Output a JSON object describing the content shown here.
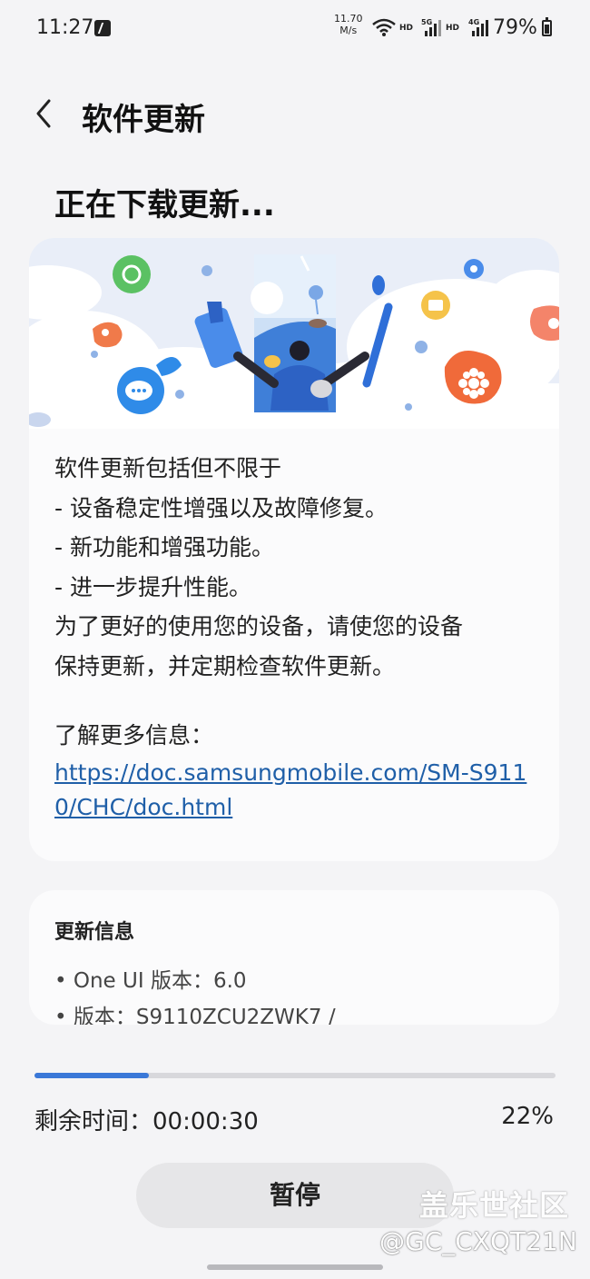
{
  "status_bar": {
    "time": "11:27",
    "speed_value": "11.70",
    "speed_unit": "M/s",
    "hd_label_1": "HD",
    "net_5g": "5G",
    "hd_label_2": "HD",
    "net_4g": "4G",
    "battery": "79%"
  },
  "header": {
    "title": "软件更新",
    "heading": "正在下载更新..."
  },
  "description": {
    "lines": [
      "软件更新包括但不限于",
      "- 设备稳定性增强以及故障修复。",
      "- 新功能和增强功能。",
      "- 进一步提升性能。",
      "为了更好的使用您的设备，请使您的设备",
      "保持更新，并定期检查软件更新。"
    ],
    "more_label": "了解更多信息：",
    "link": "https://doc.samsungmobile.com/SM-S9110/CHC/doc.html"
  },
  "update_info": {
    "title": "更新信息",
    "one_ui_version": "• One UI 版本：6.0",
    "build_version": "• 版本：S9110ZCU2ZWK7 /"
  },
  "progress": {
    "fraction": 0.22,
    "time_remaining": "剩余时间：00:00:30",
    "percent": "22%"
  },
  "actions": {
    "pause_label": "暂停"
  },
  "watermark": {
    "logo": "盖乐世社区",
    "user": "@GC_CXQT21N"
  },
  "colors": {
    "accent": "#3a78d8",
    "link": "#1f5fa8",
    "background": "#f4f4f6"
  }
}
